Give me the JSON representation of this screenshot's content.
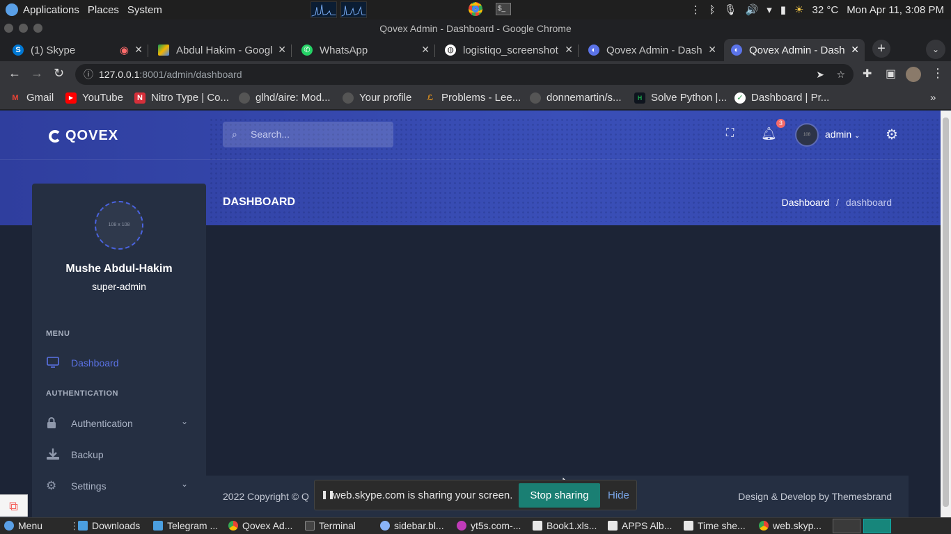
{
  "os": {
    "menus": [
      "Applications",
      "Places",
      "System"
    ],
    "temperature": "32 °C",
    "clock": "Mon Apr 11,  3:08 PM"
  },
  "chrome": {
    "window_title": "Qovex Admin - Dashboard - Google Chrome",
    "tabs": [
      {
        "label": "(1) Skype",
        "icon": "skype-icon",
        "color": "#0078d4"
      },
      {
        "label": "Abdul Hakim - Googl",
        "icon": "google-drive-icon",
        "color": "#f4b400"
      },
      {
        "label": "WhatsApp",
        "icon": "whatsapp-icon",
        "color": "#25d366"
      },
      {
        "label": "logistiqo_screenshot",
        "icon": "globe-icon",
        "color": "#ffffff"
      },
      {
        "label": "Qovex Admin - Dash",
        "icon": "qovex-icon",
        "color": "#5b73e8"
      },
      {
        "label": "Qovex Admin - Dash",
        "icon": "qovex-icon",
        "color": "#5b73e8"
      }
    ],
    "url_host": "127.0.0.1",
    "url_path": ":8001/admin/dashboard",
    "bookmarks": [
      {
        "label": "Gmail",
        "icon": "gmail-icon",
        "color": "#ea4335"
      },
      {
        "label": "YouTube",
        "icon": "youtube-icon",
        "color": "#ff0000"
      },
      {
        "label": "Nitro Type | Co...",
        "icon": "nitrotype-icon",
        "color": "#d62f3a"
      },
      {
        "label": "glhd/aire: Mod...",
        "icon": "github-icon",
        "color": "#555555"
      },
      {
        "label": "Your profile",
        "icon": "github-icon",
        "color": "#555555"
      },
      {
        "label": "Problems - Lee...",
        "icon": "leetcode-icon",
        "color": "#f89f1b"
      },
      {
        "label": "donnemartin/s...",
        "icon": "github-icon",
        "color": "#555555"
      },
      {
        "label": "Solve Python |...",
        "icon": "hackerrank-icon",
        "color": "#1ba94c"
      },
      {
        "label": "Dashboard | Pr...",
        "icon": "check-icon",
        "color": "#e8e8e8"
      }
    ]
  },
  "app": {
    "logo": "QOVEX",
    "search_placeholder": "Search...",
    "notification_count": "3",
    "user_menu": "admin",
    "page_title": "DASHBOARD",
    "breadcrumb": {
      "parent": "Dashboard",
      "sep": "/",
      "current": "dashboard"
    },
    "profile": {
      "avatar_placeholder": "108 x 108",
      "name": "Mushe Abdul-Hakim",
      "role": "super-admin"
    },
    "sidebar": {
      "menu_heading": "MENU",
      "auth_heading": "AUTHENTICATION",
      "items": [
        {
          "label": "Dashboard",
          "icon": "monitor-icon"
        },
        {
          "label": "Authentication",
          "icon": "lock-icon"
        },
        {
          "label": "Backup",
          "icon": "download-icon"
        },
        {
          "label": "Settings",
          "icon": "gear-icon"
        }
      ]
    },
    "footer": {
      "left": "2022 Copyright © Q",
      "right": "Design & Develop by Themesbrand"
    }
  },
  "share_notice": {
    "text": "web.skype.com is sharing your screen.",
    "stop": "Stop sharing",
    "hide": "Hide"
  },
  "taskbar": {
    "items": [
      "Menu",
      "Downloads",
      "Telegram ...",
      "Qovex Ad...",
      "Terminal",
      "sidebar.bl...",
      "yt5s.com-...",
      "Book1.xls...",
      "APPS Alb...",
      "Time she...",
      "web.skyp..."
    ]
  },
  "colors": {
    "accent": "#5b73e8",
    "hero": "#3a4fb8",
    "body": "#1c2436",
    "card": "#252f42",
    "stop_button": "#1a7f73"
  }
}
